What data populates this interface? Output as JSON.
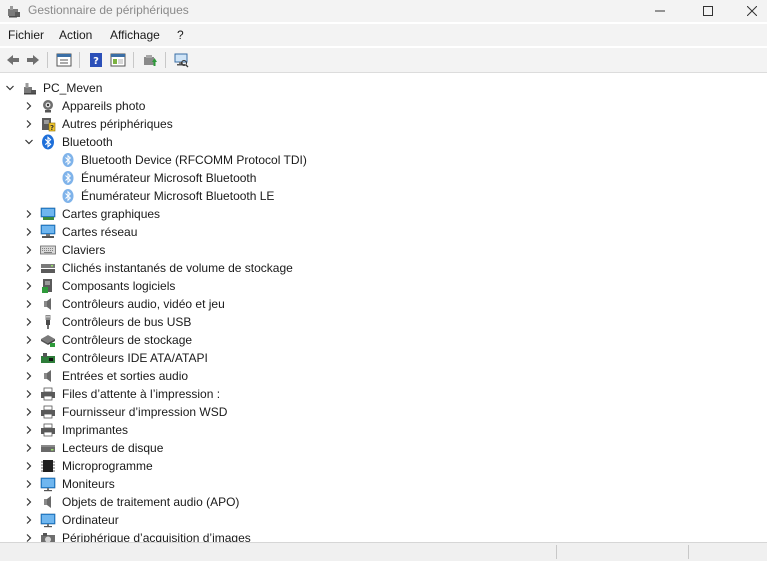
{
  "window": {
    "title": "Gestionnaire de périphériques"
  },
  "menu": {
    "file": "Fichier",
    "action": "Action",
    "view": "Affichage",
    "help": "?"
  },
  "toolbar": {
    "buttons": [
      "back-arrow-icon",
      "forward-arrow-icon",
      "properties-icon",
      "help-icon",
      "view-icon",
      "update-driver-icon",
      "scan-hardware-icon"
    ]
  },
  "tree": {
    "root": "PC_Meven",
    "categories": [
      {
        "label": "Appareils photo",
        "icon": "camera-icon",
        "expanded": false
      },
      {
        "label": "Autres périphériques",
        "icon": "unknown-device-icon",
        "expanded": false
      },
      {
        "label": "Bluetooth",
        "icon": "bluetooth-icon",
        "expanded": true,
        "children": [
          "Bluetooth Device (RFCOMM Protocol TDI)",
          "Énumérateur Microsoft Bluetooth",
          "Énumérateur Microsoft Bluetooth LE"
        ]
      },
      {
        "label": "Cartes graphiques",
        "icon": "display-adapter-icon",
        "expanded": false
      },
      {
        "label": "Cartes réseau",
        "icon": "network-adapter-icon",
        "expanded": false
      },
      {
        "label": "Claviers",
        "icon": "keyboard-icon",
        "expanded": false
      },
      {
        "label": "Clichés instantanés de volume de stockage",
        "icon": "storage-volume-icon",
        "expanded": false
      },
      {
        "label": "Composants logiciels",
        "icon": "software-component-icon",
        "expanded": false
      },
      {
        "label": "Contrôleurs audio, vidéo et jeu",
        "icon": "speaker-icon",
        "expanded": false
      },
      {
        "label": "Contrôleurs de bus USB",
        "icon": "usb-icon",
        "expanded": false
      },
      {
        "label": "Contrôleurs de stockage",
        "icon": "storage-controller-icon",
        "expanded": false
      },
      {
        "label": "Contrôleurs IDE ATA/ATAPI",
        "icon": "ide-controller-icon",
        "expanded": false
      },
      {
        "label": "Entrées et sorties audio",
        "icon": "speaker-icon",
        "expanded": false
      },
      {
        "label": "Files d’attente à l’impression :",
        "icon": "printer-icon",
        "expanded": false
      },
      {
        "label": "Fournisseur d’impression WSD",
        "icon": "printer-icon",
        "expanded": false
      },
      {
        "label": "Imprimantes",
        "icon": "printer-icon",
        "expanded": false
      },
      {
        "label": "Lecteurs de disque",
        "icon": "disk-drive-icon",
        "expanded": false
      },
      {
        "label": "Microprogramme",
        "icon": "firmware-chip-icon",
        "expanded": false
      },
      {
        "label": "Moniteurs",
        "icon": "monitor-icon",
        "expanded": false
      },
      {
        "label": "Objets de traitement audio (APO)",
        "icon": "speaker-icon",
        "expanded": false
      },
      {
        "label": "Ordinateur",
        "icon": "monitor-icon",
        "expanded": false
      },
      {
        "label": "Périphérique d’acquisition d’images",
        "icon": "camera-icon",
        "expanded": false
      }
    ]
  },
  "colors": {
    "chrome": "#f3f3f3",
    "bluetooth": "#1e6fd9",
    "bluetooth_light": "#7fb3ea",
    "monitor": "#2b8ad8",
    "text": "#1a1a1a",
    "title_text": "#8a8a8a"
  }
}
